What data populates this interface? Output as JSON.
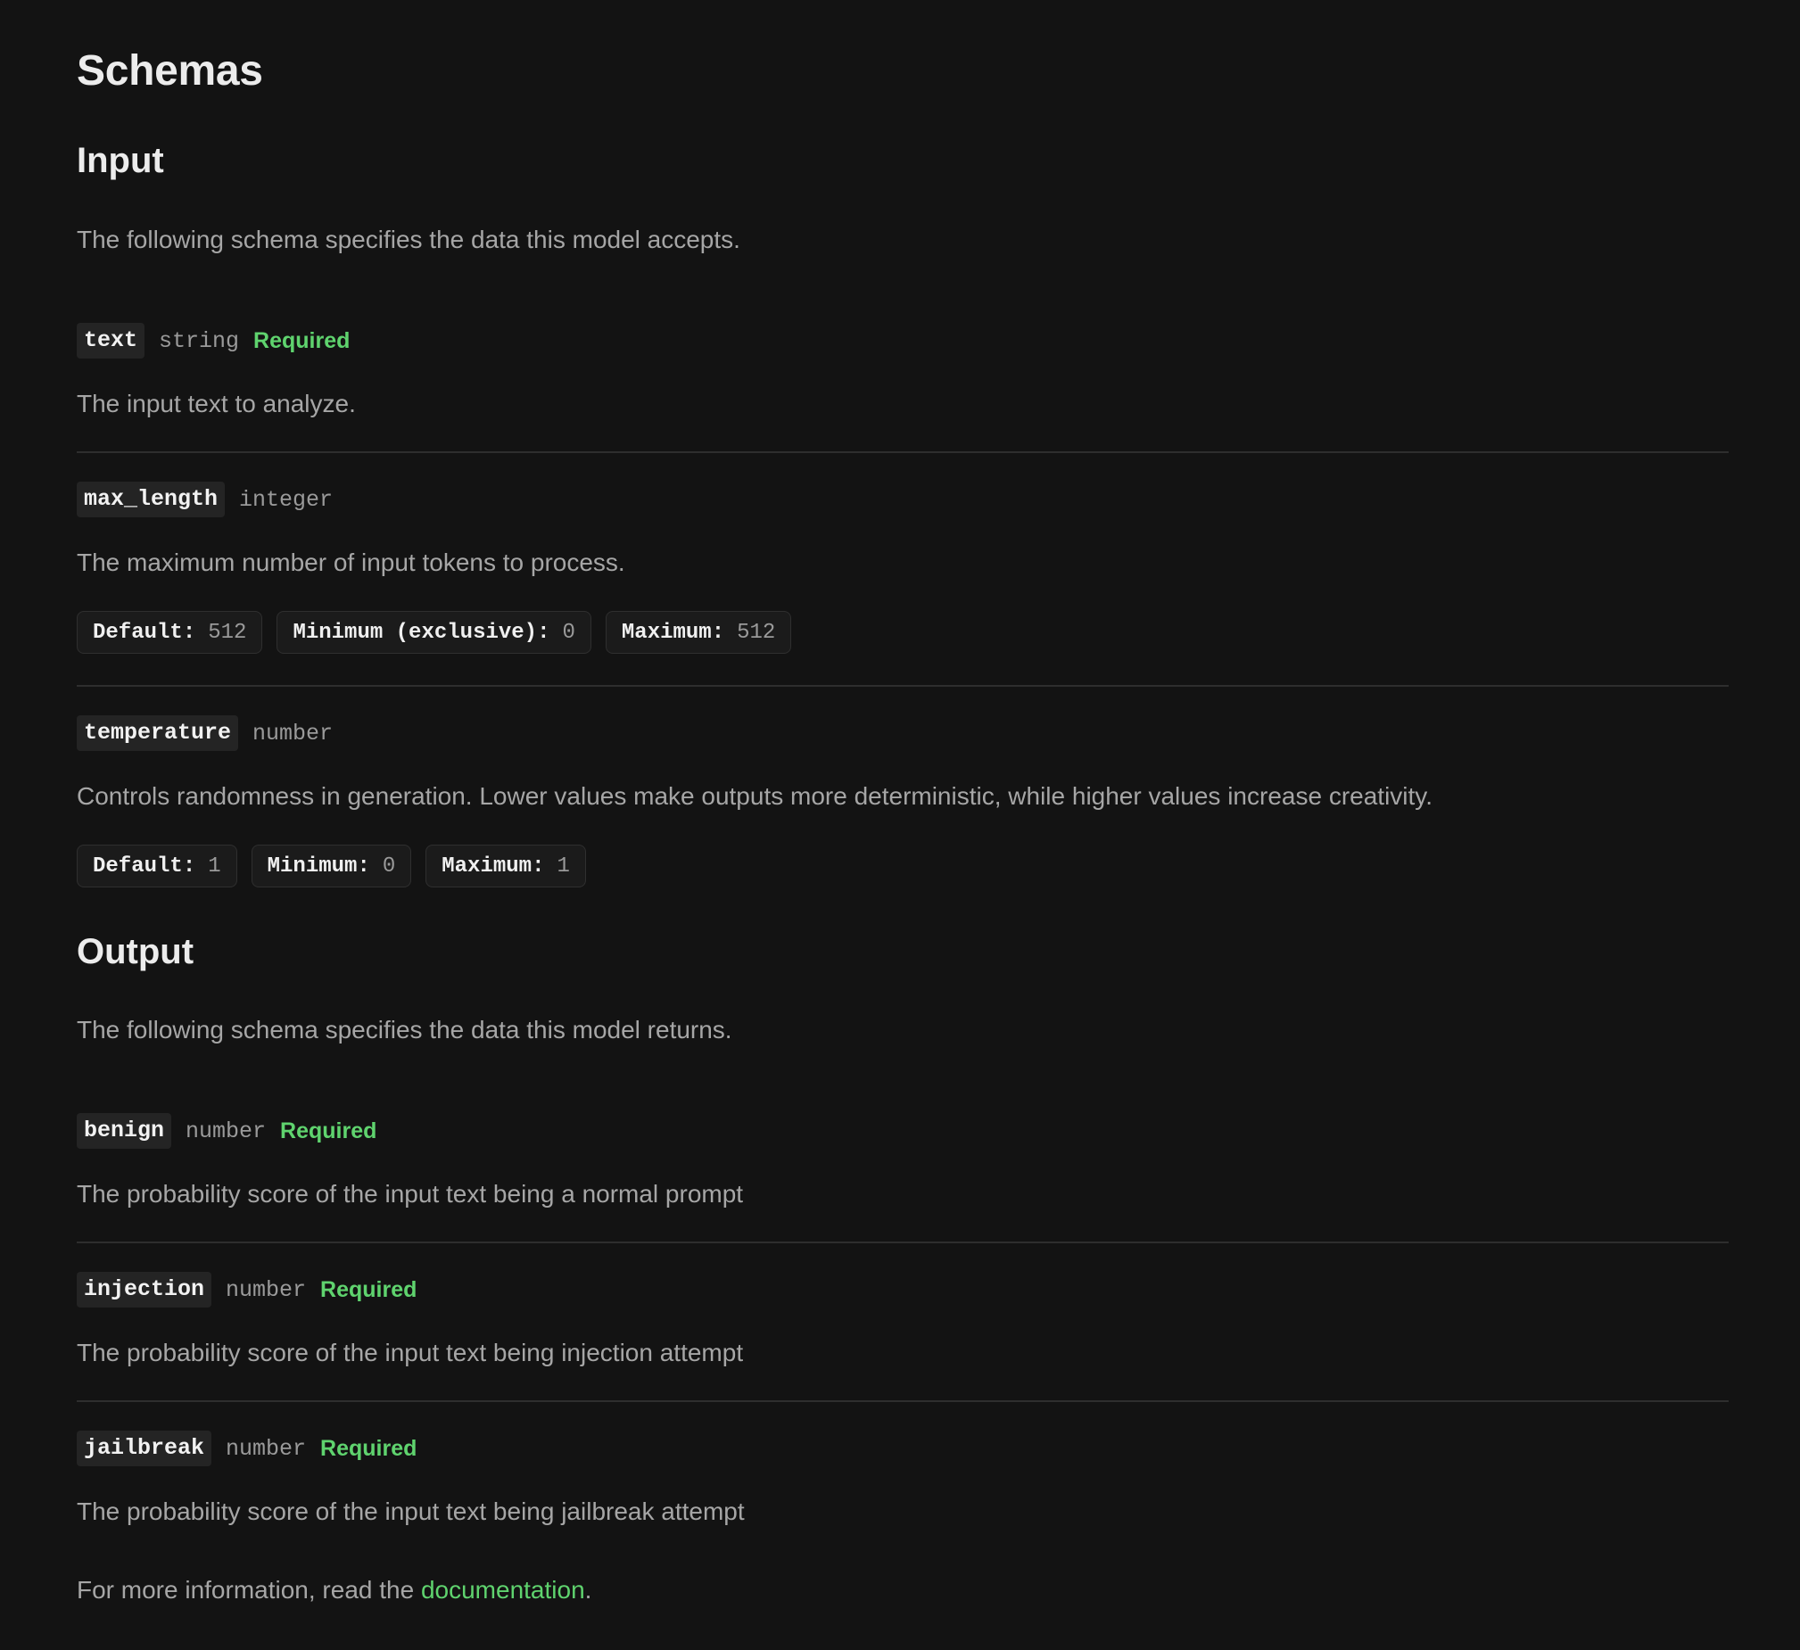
{
  "page": {
    "title": "Schemas"
  },
  "input": {
    "heading": "Input",
    "intro": "The following schema specifies the data this model accepts.",
    "fields": [
      {
        "name": "text",
        "type": "string",
        "required": "Required",
        "description": "The input text to analyze."
      },
      {
        "name": "max_length",
        "type": "integer",
        "description": "The maximum number of input tokens to process.",
        "constraints": [
          {
            "label": "Default:",
            "value": "512"
          },
          {
            "label": "Minimum (exclusive):",
            "value": "0"
          },
          {
            "label": "Maximum:",
            "value": "512"
          }
        ]
      },
      {
        "name": "temperature",
        "type": "number",
        "description": "Controls randomness in generation. Lower values make outputs more deterministic, while higher values increase creativity.",
        "constraints": [
          {
            "label": "Default:",
            "value": "1"
          },
          {
            "label": "Minimum:",
            "value": "0"
          },
          {
            "label": "Maximum:",
            "value": "1"
          }
        ]
      }
    ]
  },
  "output": {
    "heading": "Output",
    "intro": "The following schema specifies the data this model returns.",
    "fields": [
      {
        "name": "benign",
        "type": "number",
        "required": "Required",
        "description": "The probability score of the input text being a normal prompt"
      },
      {
        "name": "injection",
        "type": "number",
        "required": "Required",
        "description": "The probability score of the input text being injection attempt"
      },
      {
        "name": "jailbreak",
        "type": "number",
        "required": "Required",
        "description": "The probability score of the input text being jailbreak attempt"
      }
    ]
  },
  "footer": {
    "prefix": "For more information, read the ",
    "link_text": "documentation",
    "suffix": "."
  },
  "colors": {
    "background": "#131313",
    "accent_green": "#5fd36e",
    "muted_text": "#a6a6a6"
  }
}
